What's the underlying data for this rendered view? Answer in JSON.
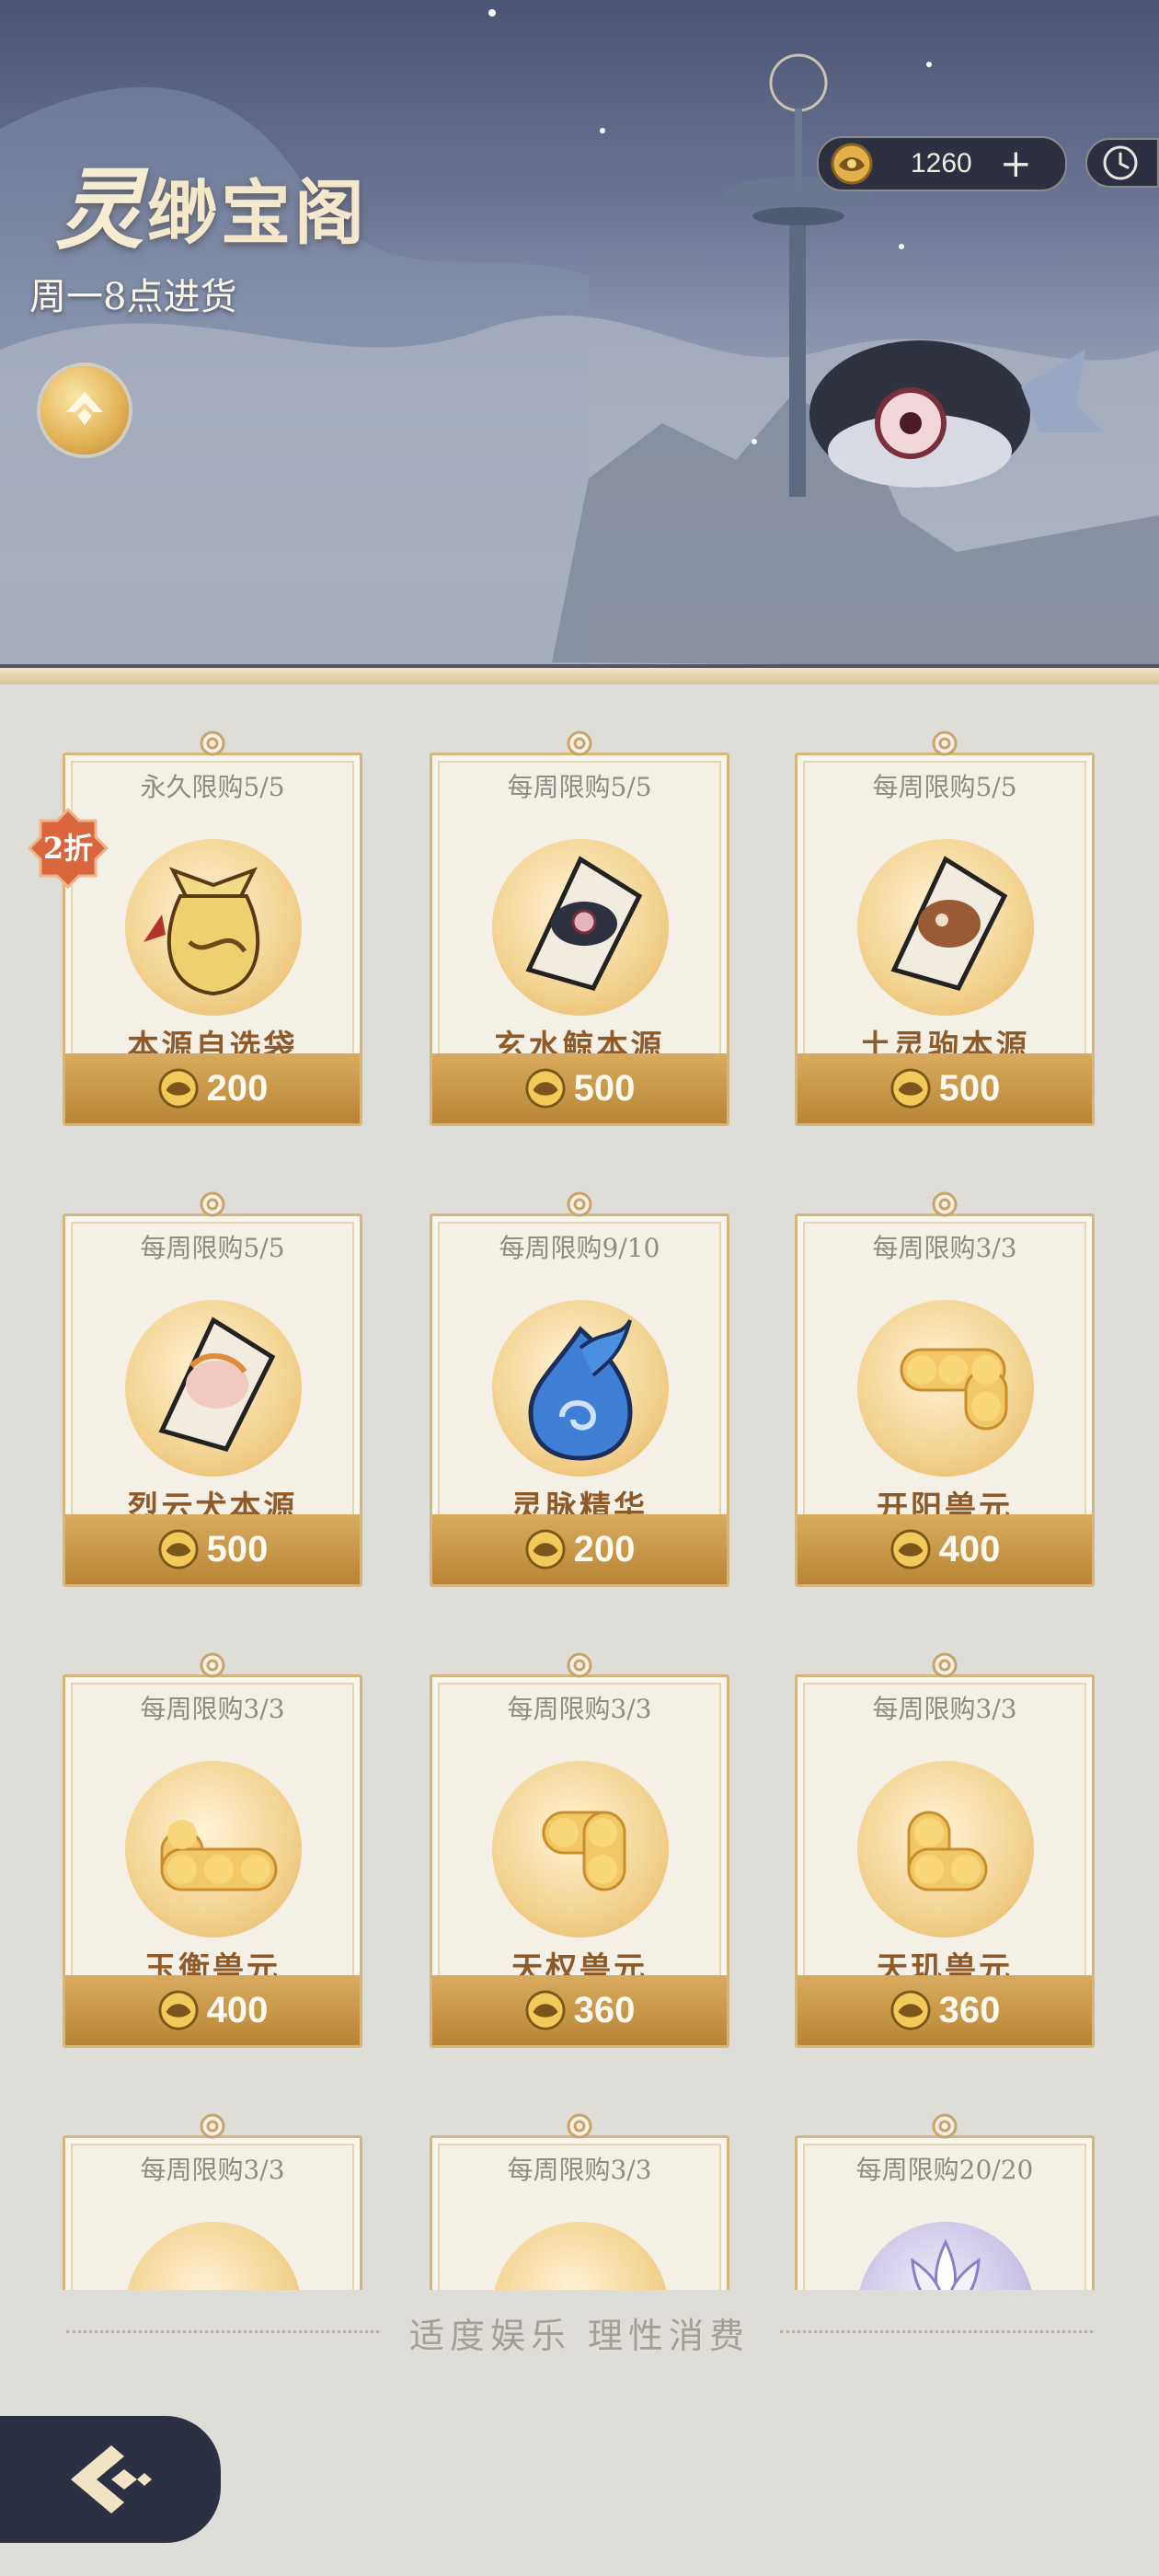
{
  "header": {
    "title_first": "灵",
    "title_rest": "缈宝阁",
    "subtitle": "周一8点进货"
  },
  "currency": {
    "amount": "1260",
    "plus": "+"
  },
  "badge": {
    "text": "2折"
  },
  "items": [
    {
      "limit": "永久限购5/5",
      "name": "本源自选袋",
      "price": "200",
      "icon": "bag-icon"
    },
    {
      "limit": "每周限购5/5",
      "name": "玄水鲸本源",
      "price": "500",
      "icon": "whale-card-icon"
    },
    {
      "limit": "每周限购5/5",
      "name": "土灵驹本源",
      "price": "500",
      "icon": "horse-card-icon"
    },
    {
      "limit": "每周限购5/5",
      "name": "烈云犬本源",
      "price": "500",
      "icon": "dog-card-icon"
    },
    {
      "limit": "每周限购9/10",
      "name": "灵脉精华",
      "price": "200",
      "icon": "spirit-flame-icon"
    },
    {
      "limit": "每周限购3/3",
      "name": "开阳兽元",
      "price": "400",
      "icon": "beast-orb-icon"
    },
    {
      "limit": "每周限购3/3",
      "name": "玉衡兽元",
      "price": "400",
      "icon": "beast-orb-icon"
    },
    {
      "limit": "每周限购3/3",
      "name": "天权兽元",
      "price": "360",
      "icon": "beast-orb-icon"
    },
    {
      "limit": "每周限购3/3",
      "name": "天玑兽元",
      "price": "360",
      "icon": "beast-orb-icon"
    },
    {
      "limit": "每周限购3/3",
      "name": "",
      "price": "",
      "icon": "beast-orb-icon"
    },
    {
      "limit": "每周限购3/3",
      "name": "",
      "price": "",
      "icon": "beast-orb-icon"
    },
    {
      "limit": "每周限购20/20",
      "name": "",
      "price": "",
      "icon": "lotus-icon"
    }
  ],
  "footer": {
    "note": "适度娱乐 理性消费"
  },
  "colors": {
    "accent": "#c9944a",
    "title": "#8f5a2a",
    "banner": "#5c6583"
  }
}
